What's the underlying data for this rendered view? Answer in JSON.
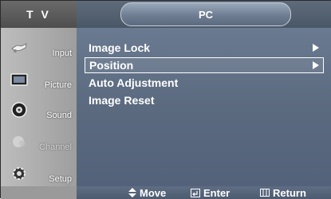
{
  "header": {
    "left_title": "T V",
    "menu_title": "PC"
  },
  "sidebar": {
    "items": [
      {
        "label": "Input",
        "icon": "input-icon"
      },
      {
        "label": "Picture",
        "icon": "picture-icon"
      },
      {
        "label": "Sound",
        "icon": "sound-icon"
      },
      {
        "label": "Channel",
        "icon": "channel-icon",
        "dimmed": true
      },
      {
        "label": "Setup",
        "icon": "setup-icon"
      }
    ]
  },
  "menu": {
    "items": [
      {
        "label": "Image Lock",
        "has_submenu": true
      },
      {
        "label": "Position",
        "has_submenu": true,
        "selected": true
      },
      {
        "label": "Auto Adjustment"
      },
      {
        "label": "Image Reset"
      }
    ]
  },
  "footer": {
    "move_label": "Move",
    "enter_label": "Enter",
    "return_label": "Return"
  }
}
